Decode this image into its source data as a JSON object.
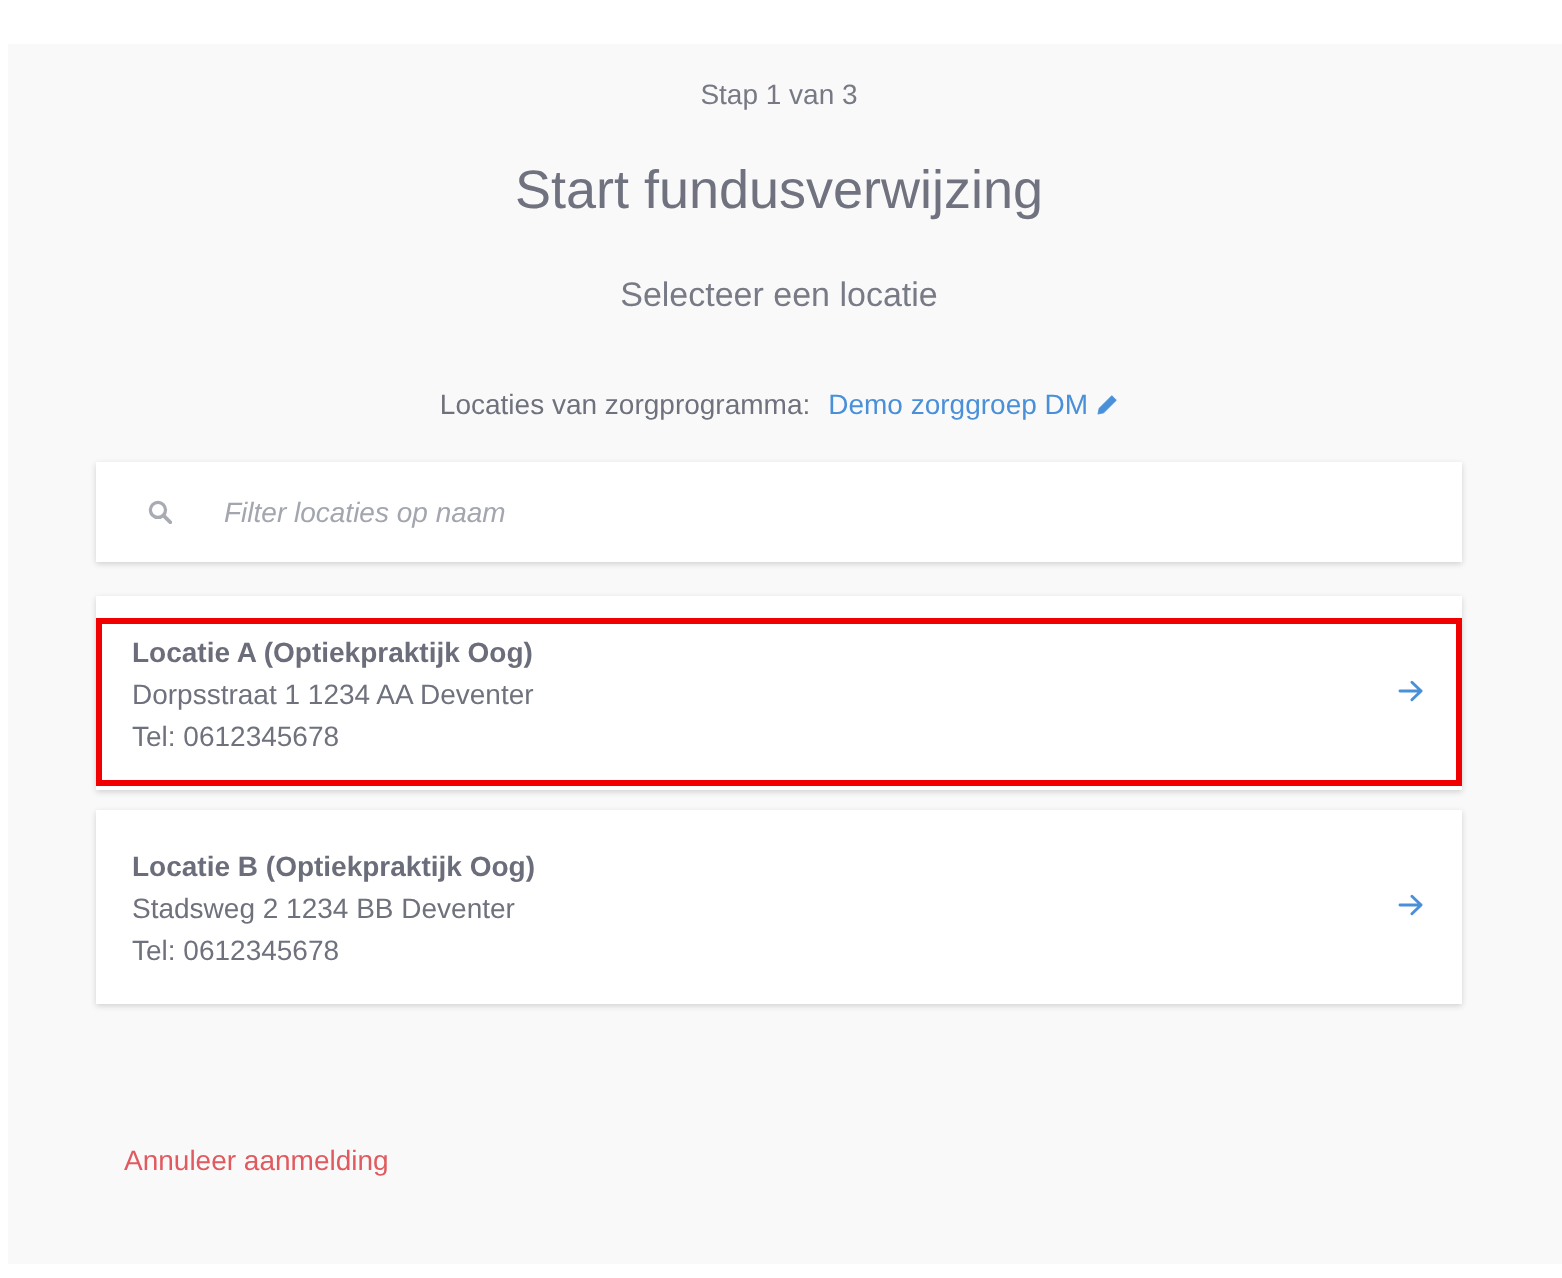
{
  "step": "Stap 1 van 3",
  "title": "Start fundusverwijzing",
  "subtitle": "Selecteer een locatie",
  "program": {
    "label": "Locaties van zorgprogramma:",
    "link": "Demo zorggroep DM"
  },
  "search": {
    "placeholder": "Filter locaties op naam"
  },
  "locations": [
    {
      "name": "Locatie A (Optiekpraktijk Oog)",
      "address": "Dorpsstraat 1 1234 AA Deventer",
      "phone": "Tel: 0612345678",
      "selected": true
    },
    {
      "name": "Locatie B (Optiekpraktijk Oog)",
      "address": "Stadsweg 2 1234 BB Deventer",
      "phone": "Tel: 0612345678",
      "selected": false
    }
  ],
  "cancel_link": "Annuleer aanmelding"
}
